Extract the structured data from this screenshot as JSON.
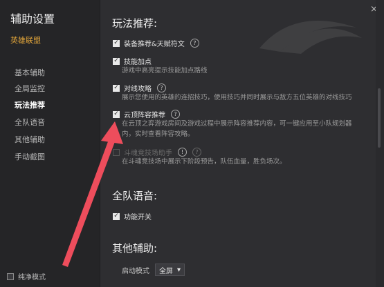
{
  "sidebar": {
    "title": "辅助设置",
    "game": "英雄联盟",
    "items": [
      {
        "label": "基本辅助"
      },
      {
        "label": "全局监控"
      },
      {
        "label": "玩法推荐",
        "active": true
      },
      {
        "label": "全队语音"
      },
      {
        "label": "其他辅助"
      },
      {
        "label": "手动截图"
      }
    ],
    "pure_mode": "纯净模式"
  },
  "sections": {
    "recommend": {
      "title": "玩法推荐:",
      "options": [
        {
          "label": "装备推荐&天赋符文",
          "checked": true,
          "help": "?"
        },
        {
          "label": "技能加点",
          "checked": true,
          "desc": "游戏中高亮提示技能加点路线"
        },
        {
          "label": "对线攻略",
          "checked": true,
          "help": "?",
          "desc": "展示您使用的英雄的连招技巧，使用技巧并同时展示与敌方五位英雄的对线技巧"
        },
        {
          "label": "云顶阵容推荐",
          "checked": true,
          "help": "?",
          "desc": "在云顶之弈游戏房间及游戏过程中展示阵容推荐内容，可一键应用至小队规划器内，实时查看阵容攻略。"
        },
        {
          "label": "斗魂竞技场助手",
          "checked": false,
          "disabled": true,
          "help": "!",
          "help2": "?",
          "desc": "在斗魂竞技场中展示下阶段预告，队伍血量，胜负场次。"
        }
      ]
    },
    "voice": {
      "title": "全队语音:",
      "option": {
        "label": "功能开关",
        "checked": true
      }
    },
    "other": {
      "title": "其他辅助:",
      "start_mode_label": "启动模式",
      "start_mode_value": "全屏"
    }
  },
  "colors": {
    "accent_orange": "#e0a43a",
    "arrow_red": "#ee4d5c"
  }
}
